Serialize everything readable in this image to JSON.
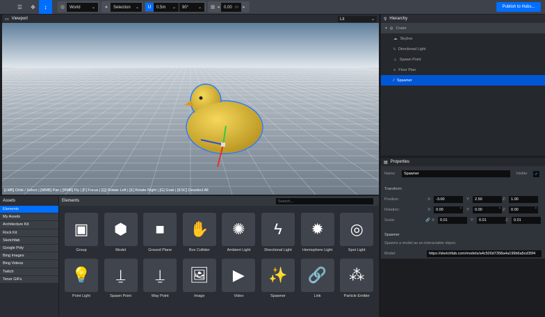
{
  "toolbar": {
    "coord_space": "World",
    "transform_pivot": "Selection",
    "translation_snap": "0.5m",
    "rotation_snap": "90°",
    "grid_height": "0.00",
    "grid_unit": "m",
    "publish_label": "Publish to Hubs..."
  },
  "viewport": {
    "title": "Viewport",
    "render_mode": "Lit",
    "hint": "[LMB] Orbit / Select | [MMB] Pan | [RMB] Fly | [F] Focus | [Q] Rotate Left | [E] Rotate Right | [G] Grab | [ESC] Deselect All"
  },
  "hierarchy": {
    "title": "Hierarchy",
    "root": "Crater",
    "items": [
      {
        "label": "Skybox",
        "icon": "cloud-icon"
      },
      {
        "label": "Directional Light",
        "icon": "bolt-icon"
      },
      {
        "label": "Spawn Point",
        "icon": "spawn-icon"
      },
      {
        "label": "Floor Plan",
        "icon": "floor-plan-icon"
      },
      {
        "label": "Spawner",
        "icon": "magic-wand-icon",
        "selected": true
      }
    ]
  },
  "properties": {
    "title": "Properties",
    "name_label": "Name:",
    "name": "Spawner",
    "visible_label": "Visible:",
    "visible": true,
    "transform_label": "Transform",
    "position_label": "Position:",
    "rotation_label": "Rotation:",
    "scale_label": "Scale:",
    "x": "X:",
    "y": "Y:",
    "z": "Z:",
    "position": [
      "-3.00",
      "2.50",
      "1.00"
    ],
    "rotation": [
      "0.00",
      "0.00",
      "0.00"
    ],
    "scale": [
      "0.01",
      "0.01",
      "0.01"
    ],
    "deg": "°",
    "component_title": "Spawner",
    "component_desc": "Spawns a model as an interactable object.",
    "model_label": "Model:",
    "model": "https://sketchfab.com/models/a4c500d7358a4a199b6a5cd35f4"
  },
  "assets": {
    "title": "Assets",
    "items": [
      "Elements",
      "My Assets",
      "Architecture Kit",
      "Rock Kit",
      "Sketchfab",
      "Google Poly",
      "Bing Images",
      "Bing Videos",
      "Twitch",
      "Tenor GIFs"
    ]
  },
  "elements": {
    "title": "Elements",
    "search_placeholder": "Search...",
    "items": [
      "Group",
      "Model",
      "Ground Plane",
      "Box Collider",
      "Ambient Light",
      "Directional Light",
      "Hemisphere Light",
      "Spot Light",
      "Point Light",
      "Spawn Point",
      "Way Point",
      "Image",
      "Video",
      "Spawner",
      "Link",
      "Particle Emitter"
    ]
  },
  "colors": {
    "accent": "#006eff",
    "selection": "#0057d6",
    "duck": "#e8c53a"
  }
}
